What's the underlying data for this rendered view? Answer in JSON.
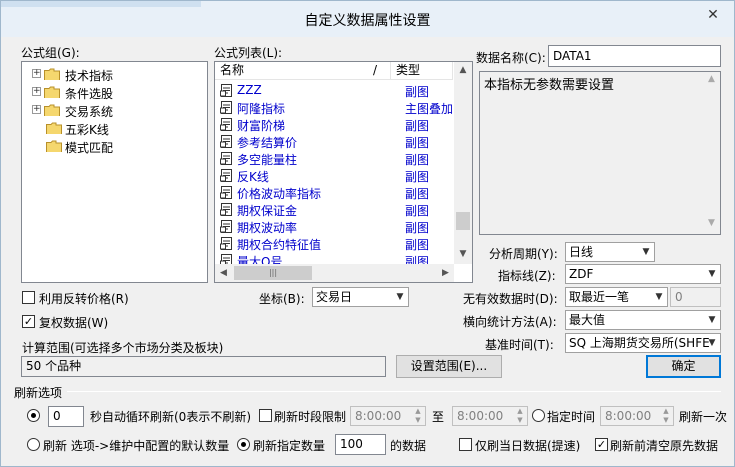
{
  "window": {
    "title": "自定义数据属性设置",
    "close_glyph": "✕"
  },
  "formula_group": {
    "label": "公式组(G):",
    "items": [
      {
        "label": "技术指标",
        "expandable": true
      },
      {
        "label": "条件选股",
        "expandable": true
      },
      {
        "label": "交易系统",
        "expandable": true
      },
      {
        "label": "五彩K线",
        "expandable": false
      },
      {
        "label": "模式匹配",
        "expandable": false
      }
    ]
  },
  "formula_list": {
    "label": "公式列表(L):",
    "columns": {
      "name": "名称",
      "sort_mark": "/",
      "type": "类型"
    },
    "rows": [
      {
        "name": "ZZZ",
        "type": "副图",
        "selected": false
      },
      {
        "name": "阿隆指标",
        "type": "主图叠加",
        "selected": false
      },
      {
        "name": "财富阶梯",
        "type": "副图",
        "selected": false
      },
      {
        "name": "参考结算价",
        "type": "副图",
        "selected": false
      },
      {
        "name": "多空能量柱",
        "type": "副图",
        "selected": false
      },
      {
        "name": "反K线",
        "type": "副图",
        "selected": false
      },
      {
        "name": "价格波动率指标",
        "type": "副图",
        "selected": false
      },
      {
        "name": "期权保证金",
        "type": "副图",
        "selected": false
      },
      {
        "name": "期权波动率",
        "type": "副图",
        "selected": false
      },
      {
        "name": "期权合约特征值",
        "type": "副图",
        "selected": false
      },
      {
        "name": "量大Q号",
        "type": "副图",
        "selected": false
      }
    ]
  },
  "data_name": {
    "label": "数据名称(C):",
    "value": "DATA1"
  },
  "description": {
    "text": "本指标无参数需要设置"
  },
  "period": {
    "label": "分析周期(Y):",
    "value": "日线"
  },
  "indicator_line": {
    "label": "指标线(Z):",
    "value": "ZDF"
  },
  "no_data_time": {
    "label": "无有效数据时(D):",
    "value": "取最近一笔",
    "extra_value": "0"
  },
  "horizontal_method": {
    "label": "横向统计方法(A):",
    "value": "最大值"
  },
  "base_time": {
    "label": "基准时间(T):",
    "value": "SQ 上海期货交易所(SHFE"
  },
  "use_reverse_price": {
    "label": "利用反转价格(R)",
    "checked": false
  },
  "adjusted_data": {
    "label": "复权数据(W)",
    "checked": true
  },
  "coordinate": {
    "label": "坐标(B):",
    "value": "交易日"
  },
  "range": {
    "label": "计算范围(可选择多个市场分类及板块)",
    "value": "50 个品种",
    "set_button": "设置范围(E)...",
    "ok_button": "确定"
  },
  "refresh": {
    "section_label": "刷新选项",
    "seconds_value": "0",
    "seconds_label": "秒自动循环刷新(0表示不刷新)",
    "limit_label": "刷新时段限制",
    "limit_checked": false,
    "time_from": "8:00:00",
    "to_label": "至",
    "time_to": "8:00:00",
    "specified_label": "指定时间",
    "specified_time": "8:00:00",
    "once_label": "刷新一次",
    "option_default_label": "刷新 选项->维护中配置的默认数量",
    "option_count_label": "刷新指定数量",
    "count_value": "100",
    "count_suffix": "的数据",
    "today_only_label": "仅刷当日数据(提速)",
    "today_only_checked": false,
    "clear_before_label": "刷新前清空原先数据",
    "clear_before_checked": true,
    "selected_mode": "auto"
  },
  "icons": {
    "close": "close-icon",
    "expand": "plus-box-icon",
    "folder": "folder-icon",
    "formula": "formula-doc-icon",
    "dropdown": "chevron-down-icon",
    "scroll_up": "scroll-up-icon",
    "scroll_down": "scroll-down-icon",
    "scroll_left": "scroll-left-icon",
    "scroll_right": "scroll-right-icon"
  },
  "colors": {
    "link_blue": "#0000cc",
    "title_bar": "#e8f0f8",
    "dialog_bg": "#f0f0f0",
    "accent": "#0078d7"
  }
}
